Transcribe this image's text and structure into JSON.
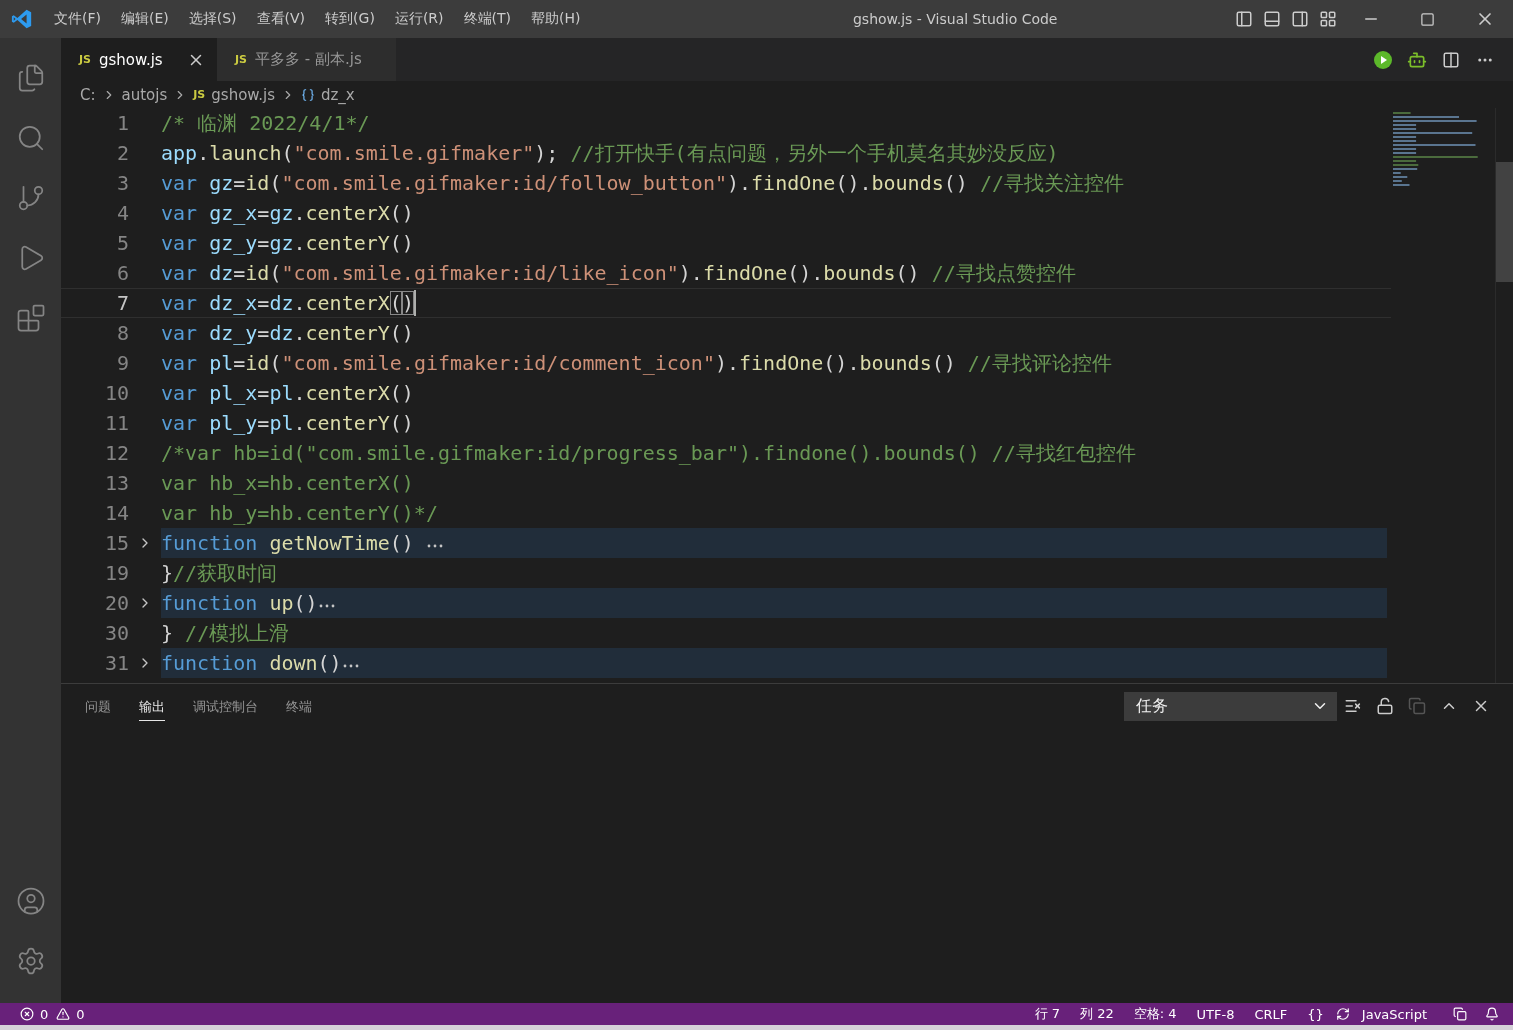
{
  "window": {
    "title": "gshow.js - Visual Studio Code"
  },
  "menu": [
    "文件(F)",
    "编辑(E)",
    "选择(S)",
    "查看(V)",
    "转到(G)",
    "运行(R)",
    "终端(T)",
    "帮助(H)"
  ],
  "tabs": [
    {
      "badge": "JS",
      "label": "gshow.js",
      "selected": true
    },
    {
      "badge": "JS",
      "label": "平多多 - 副本.js",
      "selected": false
    }
  ],
  "breadcrumb": {
    "drive": "C:",
    "folder": "autojs",
    "file_badge": "JS",
    "file": "gshow.js",
    "symbol": "dz_x"
  },
  "code_lines": [
    {
      "number": "1",
      "folded": false,
      "current": false,
      "tokens": [
        {
          "kind": "comment",
          "text": "/* 临渊 2022/4/1*/"
        }
      ]
    },
    {
      "number": "2",
      "folded": false,
      "current": false,
      "tokens": [
        {
          "kind": "variable",
          "text": "app"
        },
        {
          "kind": "plain",
          "text": "."
        },
        {
          "kind": "call",
          "text": "launch"
        },
        {
          "kind": "plain",
          "text": "("
        },
        {
          "kind": "string",
          "text": "\"com.smile.gifmaker\""
        },
        {
          "kind": "plain",
          "text": "); "
        },
        {
          "kind": "comment",
          "text": "//打开快手(有点问题，另外一个手机莫名其妙没反应)"
        }
      ]
    },
    {
      "number": "3",
      "folded": false,
      "current": false,
      "tokens": [
        {
          "kind": "keyword",
          "text": "var "
        },
        {
          "kind": "variable",
          "text": "gz"
        },
        {
          "kind": "plain",
          "text": "="
        },
        {
          "kind": "call",
          "text": "id"
        },
        {
          "kind": "plain",
          "text": "("
        },
        {
          "kind": "string",
          "text": "\"com.smile.gifmaker:id/follow_button\""
        },
        {
          "kind": "plain",
          "text": ")."
        },
        {
          "kind": "call",
          "text": "findOne"
        },
        {
          "kind": "plain",
          "text": "()."
        },
        {
          "kind": "call",
          "text": "bounds"
        },
        {
          "kind": "plain",
          "text": "() "
        },
        {
          "kind": "comment",
          "text": "//寻找关注控件"
        }
      ]
    },
    {
      "number": "4",
      "folded": false,
      "current": false,
      "tokens": [
        {
          "kind": "keyword",
          "text": "var "
        },
        {
          "kind": "variable",
          "text": "gz_x"
        },
        {
          "kind": "plain",
          "text": "="
        },
        {
          "kind": "variable",
          "text": "gz"
        },
        {
          "kind": "plain",
          "text": "."
        },
        {
          "kind": "call",
          "text": "centerX"
        },
        {
          "kind": "plain",
          "text": "()"
        }
      ]
    },
    {
      "number": "5",
      "folded": false,
      "current": false,
      "tokens": [
        {
          "kind": "keyword",
          "text": "var "
        },
        {
          "kind": "variable",
          "text": "gz_y"
        },
        {
          "kind": "plain",
          "text": "="
        },
        {
          "kind": "variable",
          "text": "gz"
        },
        {
          "kind": "plain",
          "text": "."
        },
        {
          "kind": "call",
          "text": "centerY"
        },
        {
          "kind": "plain",
          "text": "()"
        }
      ]
    },
    {
      "number": "6",
      "folded": false,
      "current": false,
      "tokens": [
        {
          "kind": "keyword",
          "text": "var "
        },
        {
          "kind": "variable",
          "text": "dz"
        },
        {
          "kind": "plain",
          "text": "="
        },
        {
          "kind": "call",
          "text": "id"
        },
        {
          "kind": "plain",
          "text": "("
        },
        {
          "kind": "string",
          "text": "\"com.smile.gifmaker:id/like_icon\""
        },
        {
          "kind": "plain",
          "text": ")."
        },
        {
          "kind": "call",
          "text": "findOne"
        },
        {
          "kind": "plain",
          "text": "()."
        },
        {
          "kind": "call",
          "text": "bounds"
        },
        {
          "kind": "plain",
          "text": "() "
        },
        {
          "kind": "comment",
          "text": "//寻找点赞控件"
        }
      ]
    },
    {
      "number": "7",
      "folded": false,
      "current": true,
      "tokens": [
        {
          "kind": "keyword",
          "text": "var "
        },
        {
          "kind": "variable",
          "text": "dz_x"
        },
        {
          "kind": "plain",
          "text": "="
        },
        {
          "kind": "variable",
          "text": "dz"
        },
        {
          "kind": "plain",
          "text": "."
        },
        {
          "kind": "call",
          "text": "centerX"
        },
        {
          "kind": "match",
          "text": "("
        },
        {
          "kind": "match",
          "text": ")"
        }
      ]
    },
    {
      "number": "8",
      "folded": false,
      "current": false,
      "tokens": [
        {
          "kind": "keyword",
          "text": "var "
        },
        {
          "kind": "variable",
          "text": "dz_y"
        },
        {
          "kind": "plain",
          "text": "="
        },
        {
          "kind": "variable",
          "text": "dz"
        },
        {
          "kind": "plain",
          "text": "."
        },
        {
          "kind": "call",
          "text": "centerY"
        },
        {
          "kind": "plain",
          "text": "()"
        }
      ]
    },
    {
      "number": "9",
      "folded": false,
      "current": false,
      "tokens": [
        {
          "kind": "keyword",
          "text": "var "
        },
        {
          "kind": "variable",
          "text": "pl"
        },
        {
          "kind": "plain",
          "text": "="
        },
        {
          "kind": "call",
          "text": "id"
        },
        {
          "kind": "plain",
          "text": "("
        },
        {
          "kind": "string",
          "text": "\"com.smile.gifmaker:id/comment_icon\""
        },
        {
          "kind": "plain",
          "text": ")."
        },
        {
          "kind": "call",
          "text": "findOne"
        },
        {
          "kind": "plain",
          "text": "()."
        },
        {
          "kind": "call",
          "text": "bounds"
        },
        {
          "kind": "plain",
          "text": "() "
        },
        {
          "kind": "comment",
          "text": "//寻找评论控件"
        }
      ]
    },
    {
      "number": "10",
      "folded": false,
      "current": false,
      "tokens": [
        {
          "kind": "keyword",
          "text": "var "
        },
        {
          "kind": "variable",
          "text": "pl_x"
        },
        {
          "kind": "plain",
          "text": "="
        },
        {
          "kind": "variable",
          "text": "pl"
        },
        {
          "kind": "plain",
          "text": "."
        },
        {
          "kind": "call",
          "text": "centerX"
        },
        {
          "kind": "plain",
          "text": "()"
        }
      ]
    },
    {
      "number": "11",
      "folded": false,
      "current": false,
      "tokens": [
        {
          "kind": "keyword",
          "text": "var "
        },
        {
          "kind": "variable",
          "text": "pl_y"
        },
        {
          "kind": "plain",
          "text": "="
        },
        {
          "kind": "variable",
          "text": "pl"
        },
        {
          "kind": "plain",
          "text": "."
        },
        {
          "kind": "call",
          "text": "centerY"
        },
        {
          "kind": "plain",
          "text": "()"
        }
      ]
    },
    {
      "number": "12",
      "folded": false,
      "current": false,
      "tokens": [
        {
          "kind": "comment",
          "text": "/*var hb=id(\"com.smile.gifmaker:id/progress_bar\").findone().bounds() //寻找红包控件"
        }
      ]
    },
    {
      "number": "13",
      "folded": false,
      "current": false,
      "tokens": [
        {
          "kind": "comment",
          "text": "var hb_x=hb.centerX()"
        }
      ]
    },
    {
      "number": "14",
      "folded": false,
      "current": false,
      "tokens": [
        {
          "kind": "comment",
          "text": "var hb_y=hb.centerY()*/"
        }
      ]
    },
    {
      "number": "15",
      "folded": true,
      "current": false,
      "tokens": [
        {
          "kind": "keyword",
          "text": "function "
        },
        {
          "kind": "call",
          "text": "getNowTime"
        },
        {
          "kind": "plain",
          "text": "() "
        }
      ]
    },
    {
      "number": "19",
      "folded": false,
      "current": false,
      "tokens": [
        {
          "kind": "plain",
          "text": "}"
        },
        {
          "kind": "comment",
          "text": "//获取时间"
        }
      ]
    },
    {
      "number": "20",
      "folded": true,
      "current": false,
      "tokens": [
        {
          "kind": "keyword",
          "text": "function "
        },
        {
          "kind": "call",
          "text": "up"
        },
        {
          "kind": "plain",
          "text": "()"
        }
      ]
    },
    {
      "number": "30",
      "folded": false,
      "current": false,
      "tokens": [
        {
          "kind": "plain",
          "text": "} "
        },
        {
          "kind": "comment",
          "text": "//模拟上滑"
        }
      ]
    },
    {
      "number": "31",
      "folded": true,
      "current": false,
      "tokens": [
        {
          "kind": "keyword",
          "text": "function "
        },
        {
          "kind": "call",
          "text": "down"
        },
        {
          "kind": "plain",
          "text": "()"
        }
      ]
    }
  ],
  "panel": {
    "tabs": [
      {
        "label": "问题",
        "selected": false
      },
      {
        "label": "输出",
        "selected": true
      },
      {
        "label": "调试控制台",
        "selected": false
      },
      {
        "label": "终端",
        "selected": false
      }
    ],
    "dropdown": "任务"
  },
  "status_bar": {
    "errors": "0",
    "warnings": "0",
    "items": [
      "行 7",
      "列 22",
      "空格: 4",
      "UTF-8",
      "CRLF",
      "{}"
    ],
    "language": "JavaScript"
  }
}
